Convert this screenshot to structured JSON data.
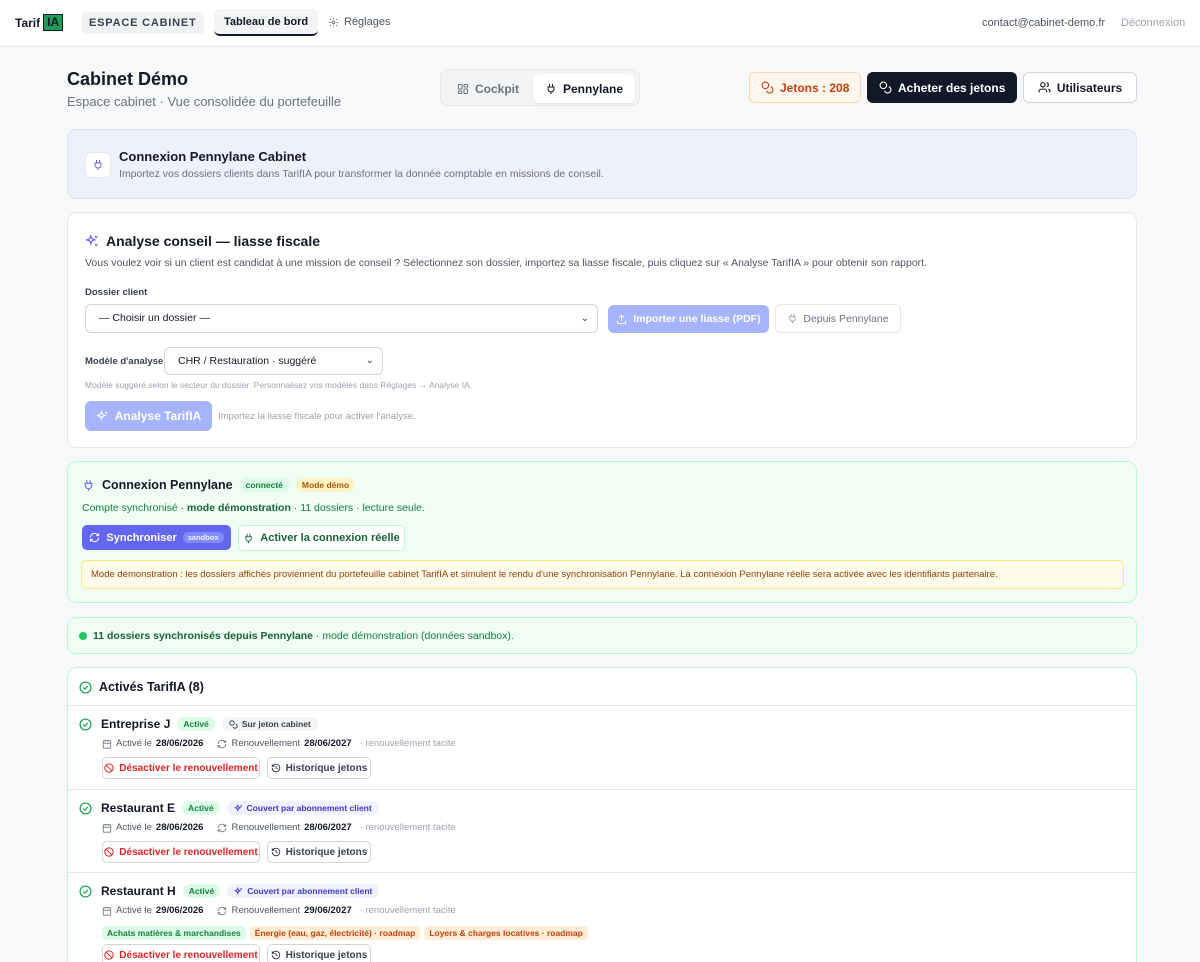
{
  "nav": {
    "logo_text": "Tarif",
    "logo_badge": "IA",
    "space_badge": "ESPACE CABINET",
    "tab_dashboard": "Tableau de bord",
    "tab_settings": "Réglages",
    "email": "contact@cabinet-demo.fr",
    "logout": "Déconnexion"
  },
  "header": {
    "title": "Cabinet Démo",
    "subtitle": "Espace cabinet · Vue consolidée du portefeuille",
    "seg_cockpit": "Cockpit",
    "seg_pennylane": "Pennylane",
    "jetons": "Jetons : 208",
    "buy": "Acheter des jetons",
    "users": "Utilisateurs"
  },
  "connexion_card": {
    "title": "Connexion Pennylane Cabinet",
    "subtitle": "Importez vos dossiers clients dans TarifIA pour transformer la donnée comptable en missions de conseil."
  },
  "analyse": {
    "title": "Analyse conseil — liasse fiscale",
    "description": "Vous voulez voir si un client est candidat à une mission de conseil ? Sélectionnez son dossier, importez sa liasse fiscale, puis cliquez sur « Analyse TarifIA » pour obtenir son rapport.",
    "dossier_label": "Dossier client",
    "dossier_value": "— Choisir un dossier —",
    "import_btn": "Importer une liasse (PDF)",
    "depuis_btn": "Depuis Pennylane",
    "modele_label": "Modèle d'analyse",
    "modele_value": "CHR / Restauration · suggéré",
    "modele_hint": "Modèle suggéré selon le secteur du dossier. Personnalisez vos modèles dans Réglages → Analyse IA.",
    "analyse_btn": "Analyse TarifIA",
    "analyse_hint": "Importez la liasse fiscale pour activer l'analyse."
  },
  "pennylane": {
    "title": "Connexion Pennylane",
    "badge_connected": "connecté",
    "badge_demo": "Mode démo",
    "sub_prefix": "Compte synchronisé · ",
    "sub_bold": "mode démonstration",
    "sub_suffix": " · 11 dossiers · lecture seule.",
    "sync_btn": "Synchroniser",
    "sync_badge": "sandbox",
    "activate_btn": "Activer la connexion réelle",
    "demo_note": "Mode démonstration : les dossiers affichés proviennent du portefeuille cabinet TarifIA et simulent le rendu d'une synchronisation Pennylane. La connexion Pennylane réelle sera activée avec les identifiants partenaire."
  },
  "synced": {
    "bold": "11 dossiers synchronisés depuis Pennylane",
    "rest": " · mode démonstration (données sandbox)."
  },
  "actives": {
    "title": "Activés TarifIA (8)",
    "entries": [
      {
        "name": "Entreprise J",
        "status": "Activé",
        "pill": "Sur jeton cabinet",
        "active_label": "Activé le",
        "active_date": "28/06/2026",
        "renew_label": "Renouvellement",
        "renew_date": "28/06/2027",
        "renew_note": "· renouvellement tacite",
        "btn_deactivate": "Désactiver le renouvellement",
        "btn_history": "Historique jetons"
      },
      {
        "name": "Restaurant E",
        "status": "Activé",
        "pill": "Couvert par abonnement client",
        "active_label": "Activé le",
        "active_date": "28/06/2026",
        "renew_label": "Renouvellement",
        "renew_date": "28/06/2027",
        "renew_note": "· renouvellement tacite",
        "btn_deactivate": "Désactiver le renouvellement",
        "btn_history": "Historique jetons"
      },
      {
        "name": "Restaurant H",
        "status": "Activé",
        "pill": "Couvert par abonnement client",
        "active_label": "Activé le",
        "active_date": "29/06/2026",
        "renew_label": "Renouvellement",
        "renew_date": "29/06/2027",
        "renew_note": "· renouvellement tacite",
        "tags": [
          "Achats matières & marchandises",
          "Énergie (eau, gaz, électricité) · roadmap",
          "Loyers & charges locatives · roadmap"
        ],
        "btn_deactivate": "Désactiver le renouvellement",
        "btn_history": "Historique jetons"
      }
    ]
  },
  "colors": {
    "accent": "#6366f1",
    "success": "#16a34a",
    "warning": "#c2410c",
    "danger": "#dc2626",
    "dark": "#111827"
  }
}
